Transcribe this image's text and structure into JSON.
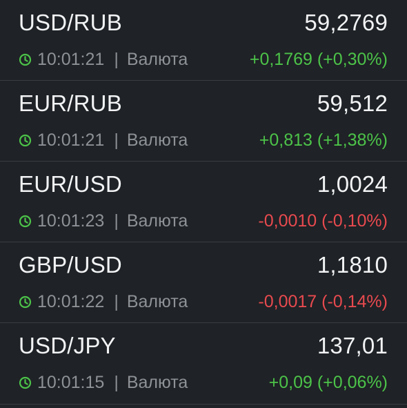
{
  "colors": {
    "background": "#1f2226",
    "divider": "#3a3e43",
    "text_primary": "#f1f3f4",
    "text_secondary": "#8d9297",
    "positive": "#4cc349",
    "negative": "#e84a4f"
  },
  "quotes": [
    {
      "pair": "USD/RUB",
      "price": "59,2769",
      "time": "10:01:21",
      "separator": "|",
      "type": "Валюта",
      "change": "+0,1769 (+0,30%)",
      "direction": "up",
      "icon": "clock-icon"
    },
    {
      "pair": "EUR/RUB",
      "price": "59,512",
      "time": "10:01:21",
      "separator": "|",
      "type": "Валюта",
      "change": "+0,813 (+1,38%)",
      "direction": "up",
      "icon": "clock-icon"
    },
    {
      "pair": "EUR/USD",
      "price": "1,0024",
      "time": "10:01:23",
      "separator": "|",
      "type": "Валюта",
      "change": "-0,0010 (-0,10%)",
      "direction": "down",
      "icon": "clock-icon"
    },
    {
      "pair": "GBP/USD",
      "price": "1,1810",
      "time": "10:01:22",
      "separator": "|",
      "type": "Валюта",
      "change": "-0,0017 (-0,14%)",
      "direction": "down",
      "icon": "clock-icon"
    },
    {
      "pair": "USD/JPY",
      "price": "137,01",
      "time": "10:01:15",
      "separator": "|",
      "type": "Валюта",
      "change": "+0,09 (+0,06%)",
      "direction": "up",
      "icon": "clock-icon"
    }
  ]
}
